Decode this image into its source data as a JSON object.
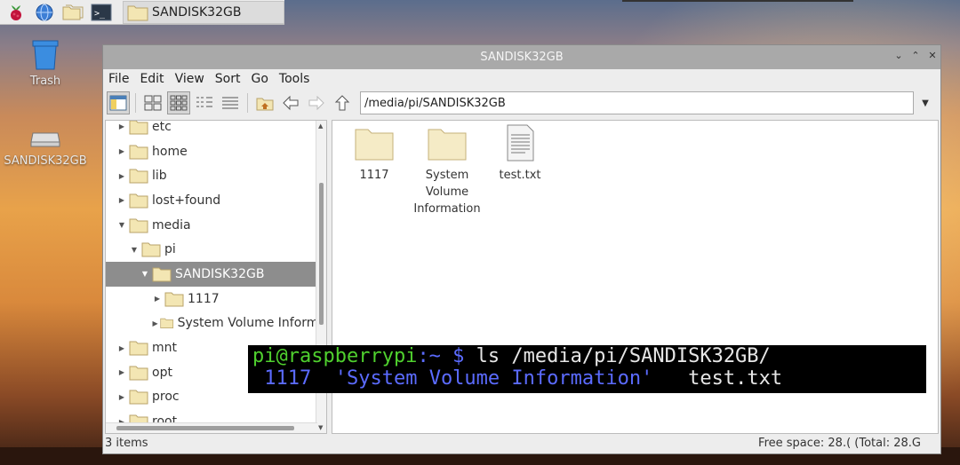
{
  "taskbar": {
    "task_label": "SANDISK32GB"
  },
  "desktop": {
    "trash_label": "Trash",
    "drive_label": "SANDISK32GB"
  },
  "window": {
    "title": "SANDISK32GB",
    "menu": [
      "File",
      "Edit",
      "View",
      "Sort",
      "Go",
      "Tools"
    ],
    "path": "/media/pi/SANDISK32GB"
  },
  "tree": [
    {
      "label": "etc",
      "arrow": "▶"
    },
    {
      "label": "home",
      "arrow": "▶"
    },
    {
      "label": "lib",
      "arrow": "▶"
    },
    {
      "label": "lost+found",
      "arrow": "▶"
    },
    {
      "label": "media",
      "arrow": "▼"
    },
    {
      "label": "pi",
      "arrow": "▼"
    },
    {
      "label": "SANDISK32GB",
      "arrow": "▼"
    },
    {
      "label": "1117",
      "arrow": "▶"
    },
    {
      "label": "System Volume Informa",
      "arrow": "▶"
    },
    {
      "label": "mnt",
      "arrow": "▶"
    },
    {
      "label": "opt",
      "arrow": "▶"
    },
    {
      "label": "proc",
      "arrow": "▶"
    },
    {
      "label": "root",
      "arrow": "▶"
    }
  ],
  "files": [
    {
      "label": "1117",
      "type": "folder"
    },
    {
      "label": "System Volume Information",
      "type": "folder"
    },
    {
      "label": "test.txt",
      "type": "text"
    }
  ],
  "status": {
    "items": "3 items",
    "free": "Free space: 28.( (Total: 28.G"
  },
  "terminal": {
    "prompt_user": "pi@raspberrypi",
    "prompt_path": ":~ $",
    "command": " ls /media/pi/SANDISK32GB/",
    "out_1117": " 1117",
    "out_svi": "'System Volume Information'",
    "out_test": "test.txt"
  }
}
